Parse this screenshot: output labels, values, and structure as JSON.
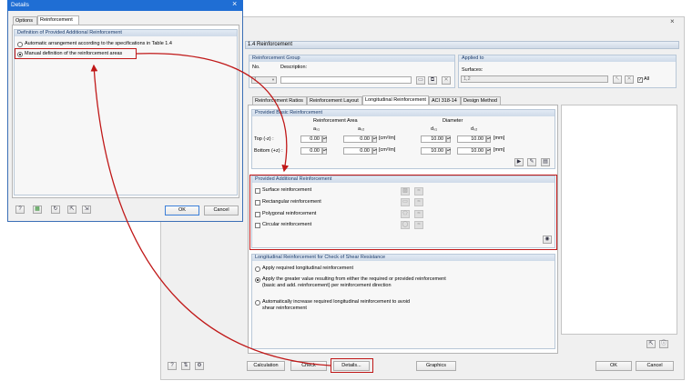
{
  "main": {
    "close_glyph": "×",
    "heading": "1.4 Reinforcement",
    "reinf_group": {
      "title": "Reinforcement Group",
      "no_label": "No.",
      "desc_label": "Description:",
      "no_value": "1"
    },
    "applied_to": {
      "title": "Applied to",
      "surfaces_label": "Surfaces:",
      "surfaces_value": "1,2",
      "all_label": "All"
    },
    "tabs": [
      "Reinforcement Ratios",
      "Reinforcement Layout",
      "Longitudinal Reinforcement",
      "ACI 318-14",
      "Design Method"
    ],
    "basic": {
      "title": "Provided Basic Reinforcement",
      "area_header": "Reinforcement Area",
      "diameter_header": "Diameter",
      "col_as1": "aₛ₁",
      "col_as2": "aₛ₂",
      "col_d1": "dₛ₁",
      "col_d2": "dₛ₂",
      "unit_area": "[cm²/m]",
      "unit_mm": "[mm]",
      "rows": [
        {
          "label": "Top (-z) :",
          "as1": "0.00",
          "as2": "0.00",
          "d1": "10.00",
          "d2": "10.00"
        },
        {
          "label": "Bottom (+z) :",
          "as1": "0.00",
          "as2": "0.00",
          "d1": "10.00",
          "d2": "10.00"
        }
      ]
    },
    "additional": {
      "title": "Provided Additional Reinforcement",
      "items": [
        "Surface reinforcement",
        "Rectangular reinforcement",
        "Polygonal reinforcement",
        "Circular reinforcement"
      ]
    },
    "shear": {
      "title": "Longitudinal Reinforcement for Check of Shear Resistance",
      "options": [
        {
          "line1": "Apply required longitudinal reinforcement",
          "line2": "",
          "selected": false
        },
        {
          "line1": "Apply the greater value resulting from either the required or provided reinforcement",
          "line2": "(basic and add. reinforcement) per reinforcement direction",
          "selected": true
        },
        {
          "line1": "Automatically increase required longitudinal reinforcement to avoid",
          "line2": "shear reinforcement",
          "selected": false
        }
      ]
    },
    "buttons": {
      "calculation": "Calculation",
      "check": "Check",
      "details": "Details...",
      "graphics": "Graphics",
      "ok": "OK",
      "cancel": "Cancel"
    }
  },
  "details": {
    "title": "Details",
    "close_glyph": "×",
    "tabs": [
      "Options",
      "Reinforcement"
    ],
    "section_title": "Definition of Provided Additional Reinforcement",
    "options": [
      {
        "label": "Automatic arrangement according to the specifications in Table 1.4",
        "selected": false
      },
      {
        "label": "Manual definition of the reinforcement areas",
        "selected": true
      }
    ],
    "ok": "OK",
    "cancel": "Cancel"
  },
  "colors": {
    "highlight": "#c01818",
    "title_bar": "#1f6ed4",
    "group_header": "#1a3a6a"
  }
}
